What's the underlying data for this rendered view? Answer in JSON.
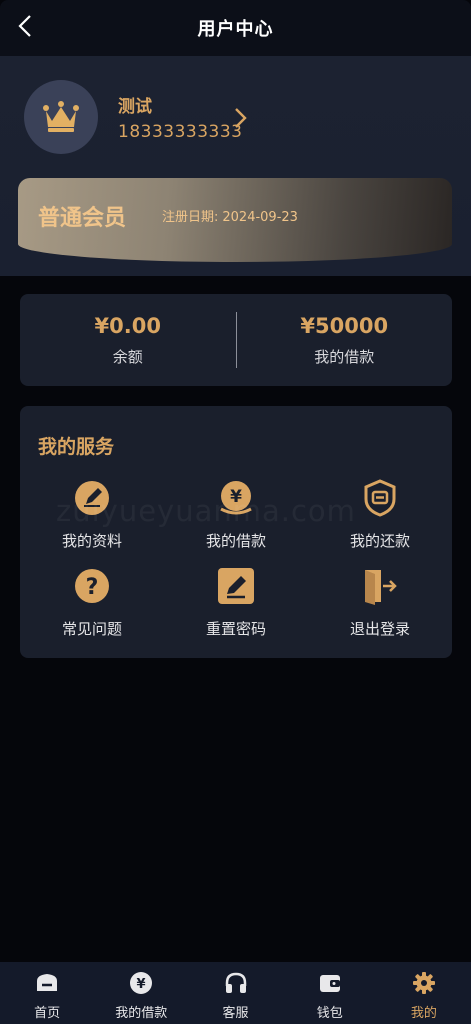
{
  "header": {
    "title": "用户中心"
  },
  "profile": {
    "name": "测试",
    "phone": "18333333333"
  },
  "member": {
    "level": "普通会员",
    "reg_label": "注册日期:",
    "reg_date": "2024-09-23"
  },
  "balance": {
    "balance_amount": "¥0.00",
    "balance_label": "余额",
    "loan_amount": "¥50000",
    "loan_label": "我的借款"
  },
  "services": {
    "title": "我的服务",
    "items": [
      {
        "label": "我的资料",
        "icon": "profile-edit-icon"
      },
      {
        "label": "我的借款",
        "icon": "loan-coin-icon"
      },
      {
        "label": "我的还款",
        "icon": "repayment-shield-icon"
      },
      {
        "label": "常见问题",
        "icon": "question-icon"
      },
      {
        "label": "重置密码",
        "icon": "pencil-icon"
      },
      {
        "label": "退出登录",
        "icon": "logout-door-icon"
      }
    ]
  },
  "watermark": "zuiyueyuanma.com",
  "tabs": [
    {
      "label": "首页",
      "icon": "home-icon"
    },
    {
      "label": "我的借款",
      "icon": "yen-coin-icon"
    },
    {
      "label": "客服",
      "icon": "headset-icon"
    },
    {
      "label": "钱包",
      "icon": "wallet-icon"
    },
    {
      "label": "我的",
      "icon": "gear-icon",
      "active": true
    }
  ],
  "colors": {
    "accent": "#d9a562",
    "background": "#05060b",
    "card": "#1a1f2c",
    "header": "#1c2231"
  }
}
